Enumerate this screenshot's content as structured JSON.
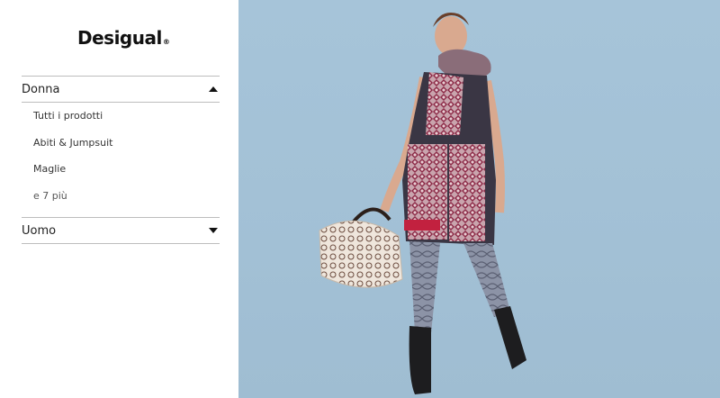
{
  "brand": {
    "name": "Desigual",
    "registered_mark": "®"
  },
  "menu": {
    "sections": [
      {
        "label": "Donna",
        "expanded": true,
        "items": [
          "Tutti i prodotti",
          "Abiti & Jumpsuit",
          "Maglie",
          "e 7 più"
        ]
      },
      {
        "label": "Uomo",
        "expanded": false,
        "items": []
      }
    ]
  },
  "colors": {
    "hero_background": "#a6c4d9",
    "divider": "#bdbdbd",
    "text": "#222222"
  },
  "icons": {
    "collapse": "triangle-up-icon",
    "expand": "triangle-down-icon"
  }
}
